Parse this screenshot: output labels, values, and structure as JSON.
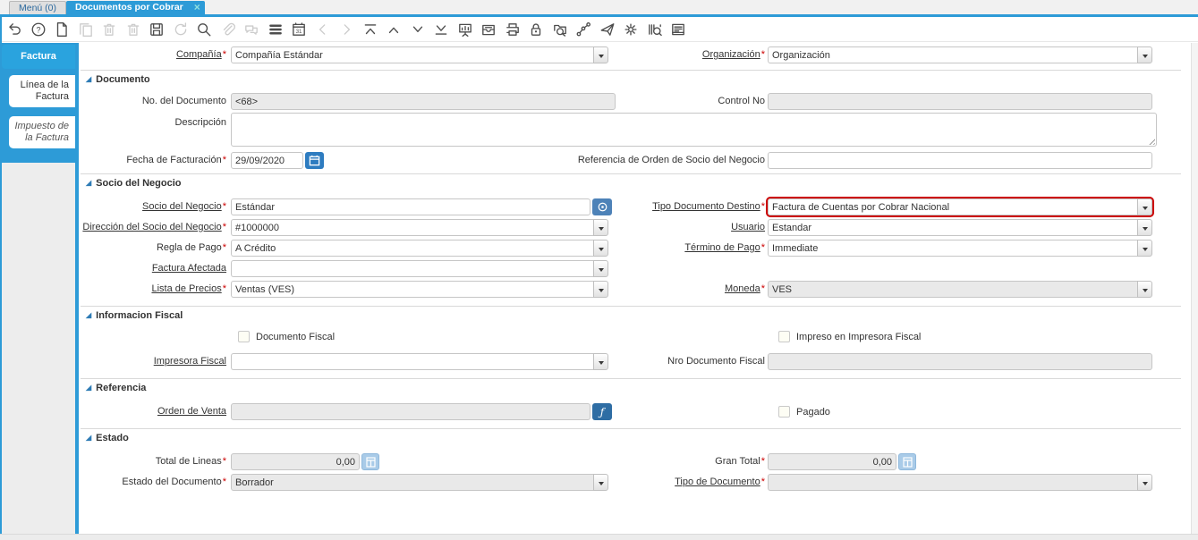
{
  "colors": {
    "accent": "#2d9bd7",
    "highlight_border": "#cc0000",
    "tab_close": "#8fe0de"
  },
  "tabbar": {
    "menu_tab": "Menú (0)",
    "doc_tab": "Documentos por Cobrar",
    "close_glyph": "×"
  },
  "toolbar": {
    "icons": [
      {
        "name": "undo",
        "disabled": false
      },
      {
        "name": "help",
        "disabled": false
      },
      {
        "name": "new-record",
        "disabled": false
      },
      {
        "name": "copy-record",
        "disabled": true
      },
      {
        "name": "delete-record",
        "disabled": true
      },
      {
        "name": "delete-selection",
        "disabled": true
      },
      {
        "name": "save",
        "disabled": false
      },
      {
        "name": "refresh",
        "disabled": true
      },
      {
        "name": "find",
        "disabled": false
      },
      {
        "name": "attachment",
        "disabled": true
      },
      {
        "name": "chat",
        "disabled": true
      },
      {
        "name": "toggle-grid",
        "disabled": false
      },
      {
        "name": "calendar",
        "disabled": false
      },
      {
        "name": "parent-record",
        "disabled": true
      },
      {
        "name": "detail-record",
        "disabled": true
      },
      {
        "name": "first-record",
        "disabled": false
      },
      {
        "name": "previous-record",
        "disabled": false
      },
      {
        "name": "next-record",
        "disabled": false
      },
      {
        "name": "last-record",
        "disabled": false
      },
      {
        "name": "report",
        "disabled": false
      },
      {
        "name": "archive",
        "disabled": false
      },
      {
        "name": "print",
        "disabled": false
      },
      {
        "name": "lock",
        "disabled": false
      },
      {
        "name": "zoom-across",
        "disabled": false
      },
      {
        "name": "workflow",
        "disabled": false
      },
      {
        "name": "request",
        "disabled": false
      },
      {
        "name": "preferences",
        "disabled": false
      },
      {
        "name": "product-info",
        "disabled": false
      },
      {
        "name": "window-report",
        "disabled": false
      }
    ]
  },
  "sidebar": {
    "tabs": [
      {
        "label": "Factura",
        "active": true
      },
      {
        "label": "Línea de la Factura",
        "active": false
      },
      {
        "label": "Impuesto de la Factura",
        "active": false
      }
    ]
  },
  "form": {
    "sections": {
      "documento": "Documento",
      "socio": "Socio del Negocio",
      "fiscal": "Informacion Fiscal",
      "referencia": "Referencia",
      "estado": "Estado"
    },
    "compania": {
      "label": "Compañía",
      "req": "*",
      "value": "Compañía Estándar"
    },
    "organizacion": {
      "label": "Organización",
      "req": "*",
      "value": "Organización"
    },
    "no_documento": {
      "label": "No. del Documento",
      "value": "<68>"
    },
    "control_no": {
      "label": "Control No",
      "value": ""
    },
    "descripcion": {
      "label": "Descripción",
      "value": ""
    },
    "fecha_facturacion": {
      "label": "Fecha de Facturación",
      "req": "*",
      "value": "29/09/2020"
    },
    "referencia_orden": {
      "label": "Referencia de Orden de Socio del Negocio",
      "value": ""
    },
    "socio": {
      "label": "Socio del Negocio",
      "req": "*",
      "value": "Estándar"
    },
    "tipo_doc_destino": {
      "label": "Tipo Documento Destino",
      "req": "*",
      "value": "Factura de Cuentas por Cobrar Nacional"
    },
    "direccion": {
      "label": "Dirección del Socio del Negocio",
      "req": "*",
      "value": "#1000000"
    },
    "usuario": {
      "label": "Usuario",
      "value": "Estandar"
    },
    "regla_pago": {
      "label": "Regla de Pago",
      "req": "*",
      "value": "A Crédito"
    },
    "termino_pago": {
      "label": "Término de Pago",
      "req": "*",
      "value": "Immediate"
    },
    "factura_afectada": {
      "label": "Factura Afectada",
      "value": ""
    },
    "lista_precios": {
      "label": "Lista de Precios",
      "req": "*",
      "value": "Ventas (VES)"
    },
    "moneda": {
      "label": "Moneda",
      "req": "*",
      "value": "VES"
    },
    "documento_fiscal": {
      "label": "Documento Fiscal",
      "checked": false
    },
    "impreso_fiscal": {
      "label": "Impreso en Impresora Fiscal",
      "checked": false
    },
    "impresora_fiscal": {
      "label": "Impresora Fiscal",
      "value": ""
    },
    "nro_doc_fiscal": {
      "label": "Nro Documento Fiscal",
      "value": ""
    },
    "orden_venta": {
      "label": "Orden de Venta",
      "value": ""
    },
    "pagado": {
      "label": "Pagado",
      "checked": false
    },
    "total_lineas": {
      "label": "Total de Lineas",
      "req": "*",
      "value": "0,00"
    },
    "gran_total": {
      "label": "Gran Total",
      "req": "*",
      "value": "0,00"
    },
    "estado_documento": {
      "label": "Estado del Documento",
      "req": "*",
      "value": "Borrador"
    },
    "tipo_documento": {
      "label": "Tipo de Documento",
      "req": "*",
      "value": ""
    }
  }
}
